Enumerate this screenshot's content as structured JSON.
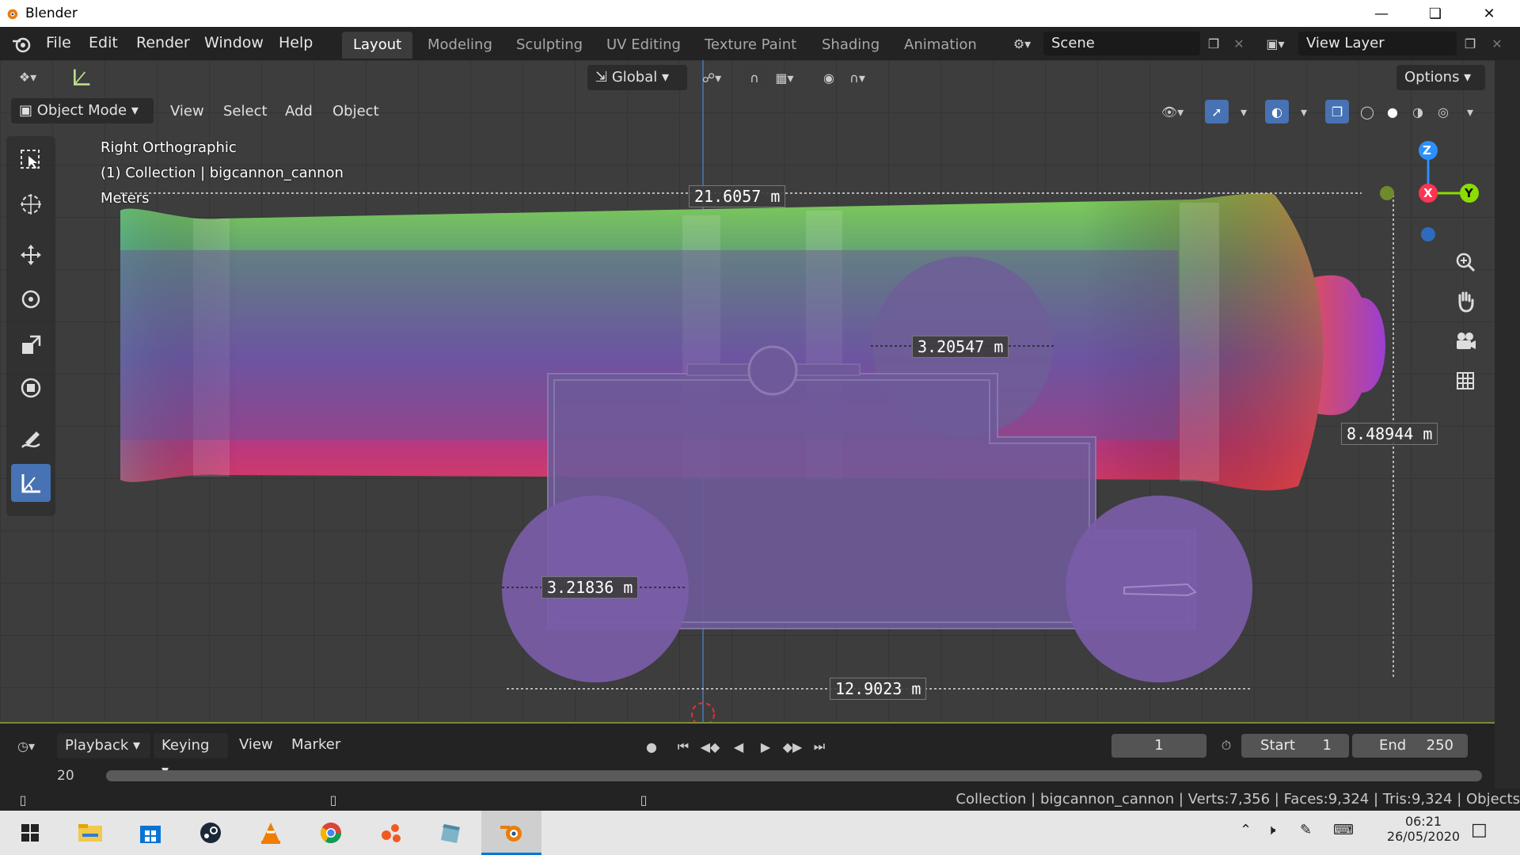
{
  "window": {
    "title": "Blender"
  },
  "menus": [
    "File",
    "Edit",
    "Render",
    "Window",
    "Help"
  ],
  "workspace_tabs": [
    {
      "label": "Layout",
      "active": true
    },
    {
      "label": "Modeling"
    },
    {
      "label": "Sculpting"
    },
    {
      "label": "UV Editing"
    },
    {
      "label": "Texture Paint"
    },
    {
      "label": "Shading"
    },
    {
      "label": "Animation"
    }
  ],
  "scene": {
    "name": "Scene"
  },
  "view_layer": {
    "name": "View Layer"
  },
  "header": {
    "orientation": "Global",
    "options": "Options"
  },
  "viewport_header": {
    "mode": "Object Mode",
    "menus": [
      "View",
      "Select",
      "Add",
      "Object"
    ]
  },
  "overlay": {
    "view_name": "Right Orthographic",
    "collection": "(1) Collection | bigcannon_cannon",
    "units": "Meters"
  },
  "measurements": {
    "top": "21.6057 m",
    "circle_upper": "3.20547 m",
    "side": "8.48944 m",
    "wheel": "3.21836 m",
    "bottom": "12.9023 m"
  },
  "gizmo": {
    "z": "Z",
    "x": "X",
    "y": "Y"
  },
  "timeline": {
    "menus": [
      "Playback",
      "Keying",
      "View",
      "Marker"
    ],
    "current_frame": "1",
    "start_label": "Start",
    "start_value": "1",
    "end_label": "End",
    "end_value": "250",
    "ruler_first": "20"
  },
  "status": {
    "text": "Collection | bigcannon_cannon | Verts:7,356 | Faces:9,324 | Tris:9,324 | Objects"
  },
  "taskbar": {
    "time": "06:21",
    "date": "26/05/2020",
    "apps": [
      "file-explorer-icon",
      "store-icon",
      "steam-icon",
      "vlc-icon",
      "chrome-icon",
      "app-orange-icon",
      "notebook-icon",
      "blender-icon"
    ]
  },
  "colors": {
    "accent": "#4772b3",
    "header": "#232323",
    "viewport": "#3d3d3d"
  }
}
